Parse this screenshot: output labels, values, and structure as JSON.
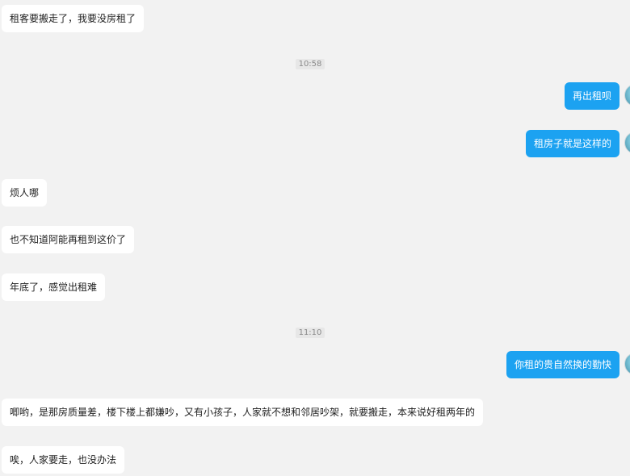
{
  "chat": {
    "messages": [
      {
        "text": "租客要搬走了，我要没房租了"
      },
      {
        "text": "再出租呗"
      },
      {
        "text": "租房子就是这样的"
      },
      {
        "text": "烦人哪"
      },
      {
        "text": "也不知道阿能再租到这价了"
      },
      {
        "text": "年底了，感觉出租难"
      },
      {
        "text": "你租的贵自然换的勤快"
      },
      {
        "text": "唧哟，是那房质量差，楼下楼上都嫌吵，又有小孩子，人家就不想和邻居吵架，就要搬走，本来说好租两年的"
      },
      {
        "text": "唉，人家要走，也没办法"
      }
    ],
    "timestamps": [
      "10:58",
      "11:10"
    ]
  },
  "colors": {
    "background": "#f2f2f2",
    "incoming_bubble": "#ffffff",
    "outgoing_bubble": "#1ca2f1"
  }
}
